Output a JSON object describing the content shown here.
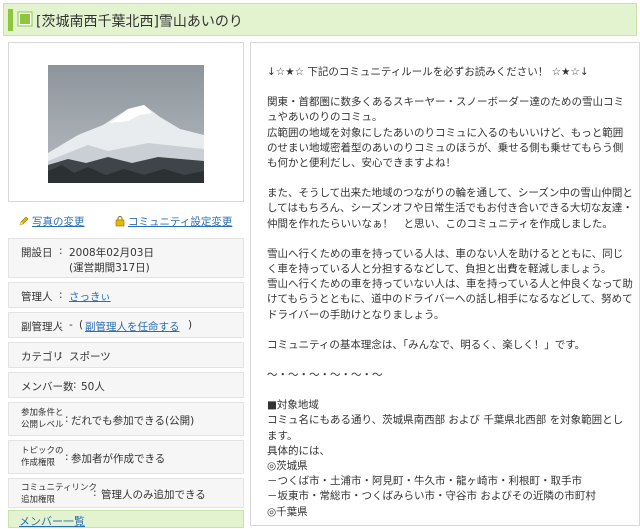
{
  "header": {
    "title": "[茨城南西千葉北西]雪山あいのり"
  },
  "actions": {
    "photo_change": "写真の変更",
    "settings_change": "コミュニティ設定変更"
  },
  "info": {
    "opened_label": "開設日",
    "opened_value": "2008年02月03日",
    "opened_sub": "(運営期間317日)",
    "admin_label": "管理人",
    "admin_value": "さっきぃ",
    "subadmin_label": "副管理人",
    "subadmin_dash": "-",
    "subadmin_link": "副管理人を任命する",
    "category_label": "カテゴリ",
    "category_value": "スポーツ",
    "members_label": "メンバー数",
    "members_value": "50人",
    "join_label_1": "参加条件と",
    "join_label_2": "公開レベル",
    "join_value": "だれでも参加できる(公開)",
    "topic_label_1": "トピックの",
    "topic_label_2": "作成権限",
    "topic_value": "参加者が作成できる",
    "link_label_1": "コミュニティリンク",
    "link_label_2": "追加権限",
    "link_value": "管理人のみ追加できる"
  },
  "members_bar": {
    "label": "メンバー一覧"
  },
  "description": {
    "lines": [
      "↓☆★☆ 下記のコミュニティルールを必ずお読みください！ ☆★☆↓",
      "",
      "関東・首都圏に数多くあるスキーヤー・スノーボーダー達のための雪山コミュやあいのりのコミュ。",
      "広範囲の地域を対象にしたあいのりコミュに入るのもいいけど、もっと範囲のせまい地域密着型のあいのりコミュのほうが、乗せる側も乗せてもらう側も何かと便利だし、安心できますよね！",
      "",
      "また、そうして出来た地域のつながりの輪を通して、シーズン中の雪山仲間としてはもちろん、シーズンオフや日常生活でもお付き合いできる大切な友達・仲間を作れたらいいなぁ！　と思い、このコミュニティを作成しました。",
      "",
      "雪山へ行くための車を持っている人は、車のない人を助けるとともに、同じく車を持っている人と分担するなどして、負担と出費を軽減しましょう。",
      "雪山へ行くための車を持っていない人は、車を持っている人と仲良くなって助けてもらうとともに、道中のドライバーへの話し相手になるなどして、努めてドライバーの手助けとなりましょう。",
      "",
      "コミュニティの基本理念は、「みんなで、明るく、楽しく！」です。",
      "",
      "～・～・～・～・～・～",
      "",
      "■対象地域",
      "コミュ名にもある通り、茨城県南西部 および 千葉県北西部 を対象範囲とします。",
      "具体的には、",
      "◎茨城県",
      "－つくば市・土浦市・阿見町・牛久市・龍ヶ崎市・利根町・取手市",
      "－坂東市・常総市・つくばみらい市・守谷市 およびその近隣の市町村",
      "◎千葉県"
    ]
  }
}
